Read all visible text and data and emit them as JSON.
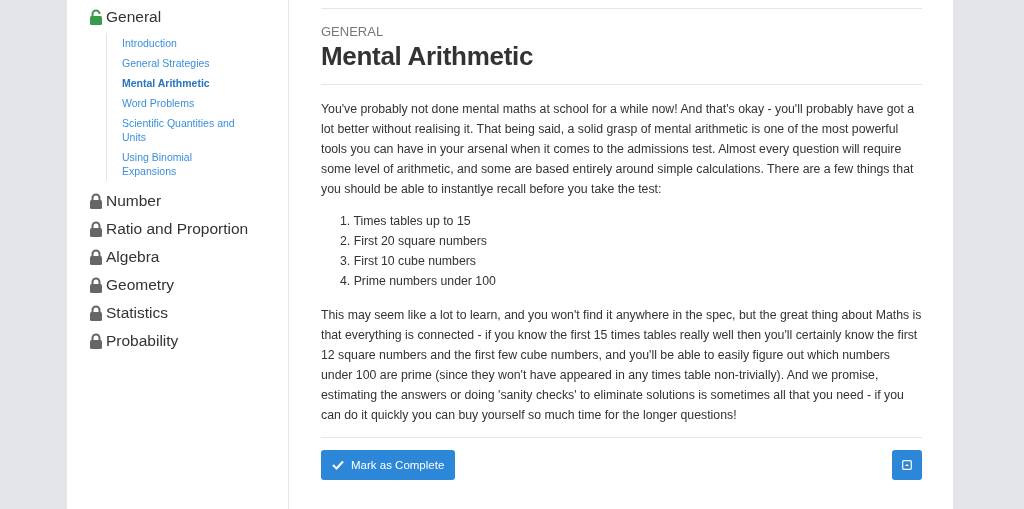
{
  "sidebar": {
    "sections": [
      {
        "label": "General",
        "locked": false,
        "children": [
          {
            "label": "Introduction",
            "selected": false
          },
          {
            "label": "General Strategies",
            "selected": false
          },
          {
            "label": "Mental Arithmetic",
            "selected": true
          },
          {
            "label": "Word Problems",
            "selected": false
          },
          {
            "label": "Scientific Quantities and Units",
            "selected": false
          },
          {
            "label": "Using Binomial Expansions",
            "selected": false
          }
        ]
      },
      {
        "label": "Number",
        "locked": true
      },
      {
        "label": "Ratio and Proportion",
        "locked": true
      },
      {
        "label": "Algebra",
        "locked": true
      },
      {
        "label": "Geometry",
        "locked": true
      },
      {
        "label": "Statistics",
        "locked": true
      },
      {
        "label": "Probability",
        "locked": true
      }
    ]
  },
  "article": {
    "category": "GENERAL",
    "title": "Mental Arithmetic",
    "blocks": [
      {
        "kind": "paragraph",
        "text": "You've probably not done mental maths at school for a while now! And that's okay - you'll probably have got a lot better without realising it. That being said, a solid grasp of mental arithmetic is one of the most powerful tools you can have in your arsenal when it comes to the admissions test. Almost every question will require some level of arithmetic, and some are based entirely around simple calculations. There are a few things that you should be able to instantlye recall before you take the test:"
      },
      {
        "kind": "list",
        "items": [
          "1. Times tables up to 15",
          "2. First 20 square numbers",
          "3. First 10 cube numbers",
          "4. Prime numbers under 100"
        ]
      },
      {
        "kind": "paragraph",
        "text": "This may seem like a lot to learn, and you won't find it anywhere in the spec, but the great thing about Maths is that everything is connected - if you know the first 15 times tables really well then you'll certainly know the first 12 square numbers and the first few cube numbers, and you'll be able to easily figure out which numbers under 100 are prime (since they won't have appeared in any times table non-trivially). And we promise, estimating the answers or doing 'sanity checks' to eliminate solutions is sometimes all that you need - if you can do it quickly you can buy yourself so much time for the longer questions!"
      }
    ],
    "complete_button": "Mark as Complete"
  }
}
